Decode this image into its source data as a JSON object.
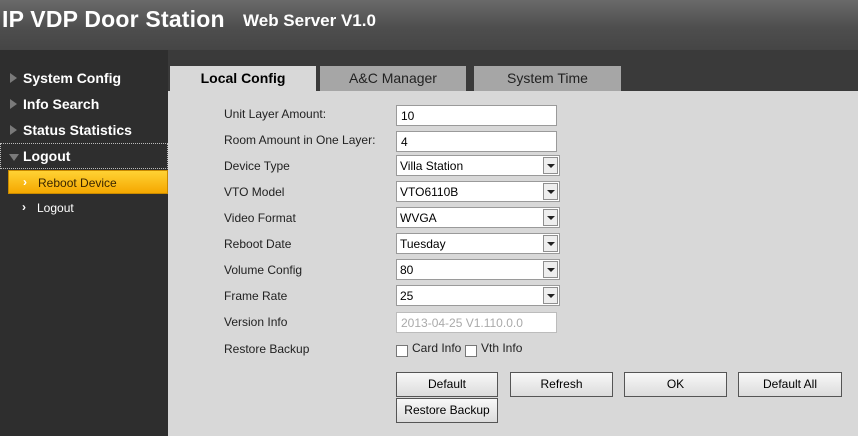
{
  "header": {
    "title": "IP VDP Door Station",
    "subtitle": "Web Server V1.0"
  },
  "sidebar": {
    "items": [
      {
        "label": "System Config"
      },
      {
        "label": "Info Search"
      },
      {
        "label": "Status Statistics"
      },
      {
        "label": "Logout"
      }
    ],
    "sub_items": [
      {
        "label": "Reboot Device"
      },
      {
        "label": "Logout"
      }
    ]
  },
  "tabs": [
    {
      "label": "Local Config"
    },
    {
      "label": "A&C Manager"
    },
    {
      "label": "System Time"
    }
  ],
  "form": {
    "unit_layer_amount": {
      "label": "Unit Layer Amount:",
      "value": "10"
    },
    "room_amount": {
      "label": "Room Amount in One Layer:",
      "value": "4"
    },
    "device_type": {
      "label": "Device Type",
      "value": "Villa Station"
    },
    "vto_model": {
      "label": "VTO Model",
      "value": "VTO6110B"
    },
    "video_format": {
      "label": "Video Format",
      "value": "WVGA"
    },
    "reboot_date": {
      "label": "Reboot Date",
      "value": "Tuesday"
    },
    "volume_config": {
      "label": "Volume Config",
      "value": "80"
    },
    "frame_rate": {
      "label": "Frame Rate",
      "value": "25"
    },
    "version_info": {
      "label": "Version Info",
      "value": "2013-04-25 V1.110.0.0"
    },
    "restore_backup": {
      "label": "Restore Backup",
      "card_info": "Card Info",
      "vth_info": "Vth Info"
    }
  },
  "buttons": {
    "default": "Default",
    "refresh": "Refresh",
    "ok": "OK",
    "default_all": "Default All",
    "restore_backup": "Restore Backup"
  }
}
